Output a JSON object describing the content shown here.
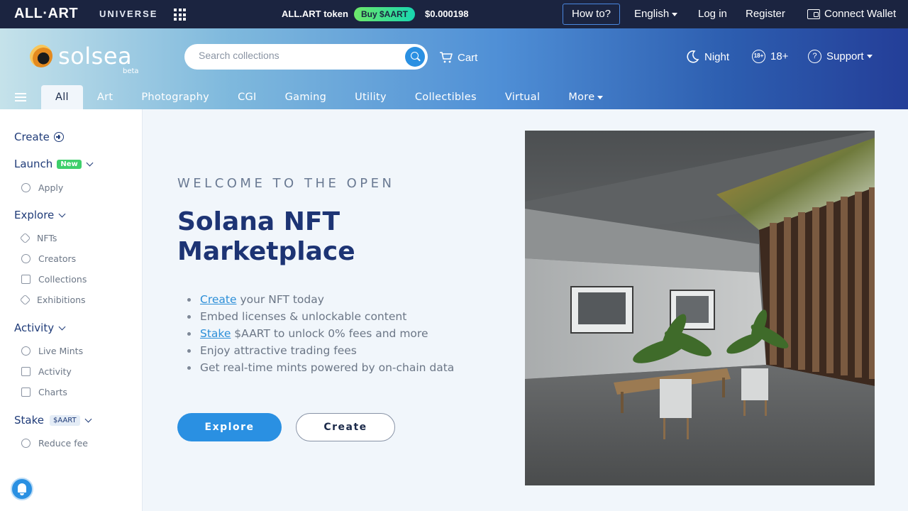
{
  "topbar": {
    "brand": "ALL·ART",
    "universe": "UNIVERSE",
    "token_label": "ALL.ART token",
    "buy_label": "Buy $AART",
    "price": "$0.000198",
    "howto": "How to?",
    "language": "English",
    "login": "Log in",
    "register": "Register",
    "wallet": "Connect Wallet"
  },
  "header": {
    "logo_text": "solsea",
    "logo_beta": "beta",
    "search_placeholder": "Search collections",
    "cart": "Cart",
    "night": "Night",
    "age_badge": "18+",
    "age": "18+",
    "help_mark": "?",
    "support": "Support"
  },
  "tabs": [
    {
      "label": "All",
      "active": true
    },
    {
      "label": "Art"
    },
    {
      "label": "Photography"
    },
    {
      "label": "CGI"
    },
    {
      "label": "Gaming"
    },
    {
      "label": "Utility"
    },
    {
      "label": "Collectibles"
    },
    {
      "label": "Virtual"
    },
    {
      "label": "More"
    }
  ],
  "sidebar": {
    "create": "Create",
    "launch": "Launch",
    "launch_badge": "New",
    "apply": "Apply",
    "explore": "Explore",
    "nfts": "NFTs",
    "creators": "Creators",
    "collections": "Collections",
    "exhibitions": "Exhibitions",
    "activity_head": "Activity",
    "live_mints": "Live Mints",
    "activity": "Activity",
    "charts": "Charts",
    "stake": "Stake",
    "stake_badge": "$AART",
    "reduce_fee": "Reduce fee"
  },
  "hero": {
    "eyebrow": "WELCOME TO THE OPEN",
    "title": "Solana NFT Marketplace",
    "bullets": [
      {
        "link": "Create",
        "text": " your NFT today"
      },
      {
        "link": "",
        "text": "Embed licenses & unlockable content"
      },
      {
        "link": "Stake",
        "text": " $AART to unlock 0% fees and more"
      },
      {
        "link": "",
        "text": "Enjoy attractive trading fees"
      },
      {
        "link": "",
        "text": "Get real-time mints powered by on-chain data"
      }
    ],
    "explore_btn": "Explore",
    "create_btn": "Create"
  },
  "colors": {
    "topbar_bg": "#1b2440",
    "accent": "#2a90e2",
    "title": "#1d3474",
    "new_badge": "#3ecf6b"
  }
}
